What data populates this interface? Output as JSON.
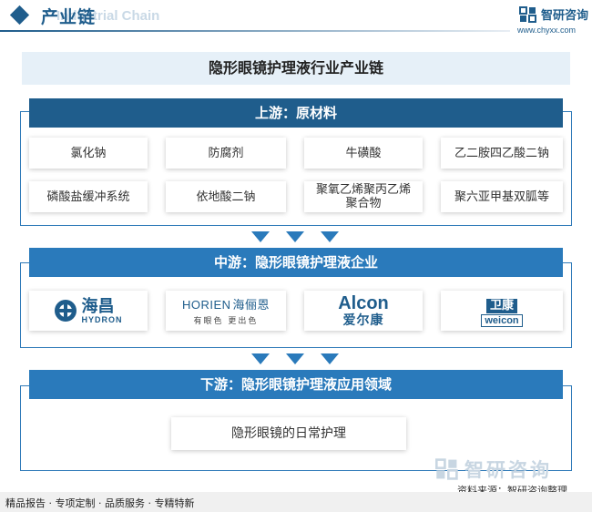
{
  "header": {
    "title": "产业链",
    "subtitle": "Industrial Chain",
    "brand_name": "智研咨询",
    "brand_url": "www.chyxx.com"
  },
  "main_title": "隐形眼镜护理液行业产业链",
  "upstream": {
    "label": "上游：原材料",
    "items": [
      "氯化钠",
      "防腐剂",
      "牛磺酸",
      "乙二胺四乙酸二钠",
      "磷酸盐缓冲系统",
      "依地酸二钠",
      "聚氧乙烯聚丙乙烯聚合物",
      "聚六亚甲基双胍等"
    ]
  },
  "midstream": {
    "label": "中游：隐形眼镜护理液企业",
    "logos": {
      "hydron_cn": "海昌",
      "hydron_en": "HYDRON",
      "horien_en": "HORIEN",
      "horien_cn": "海俪恩",
      "horien_slogan": "有眼色 更出色",
      "alcon_en": "Alcon",
      "alcon_cn": "爱尔康",
      "weicon_cn": "卫康",
      "weicon_en": "weicon"
    }
  },
  "downstream": {
    "label": "下游：隐形眼镜护理液应用领域",
    "items": [
      "隐形眼镜的日常护理"
    ]
  },
  "source": "资料来源：智研咨询整理",
  "watermark": "智研咨询",
  "footer": "精品报告 · 专项定制 · 品质服务 · 专精特新",
  "colors": {
    "primary_dark": "#1f5d8c",
    "primary": "#2a7abb",
    "title_bg": "#e6f0f8"
  }
}
